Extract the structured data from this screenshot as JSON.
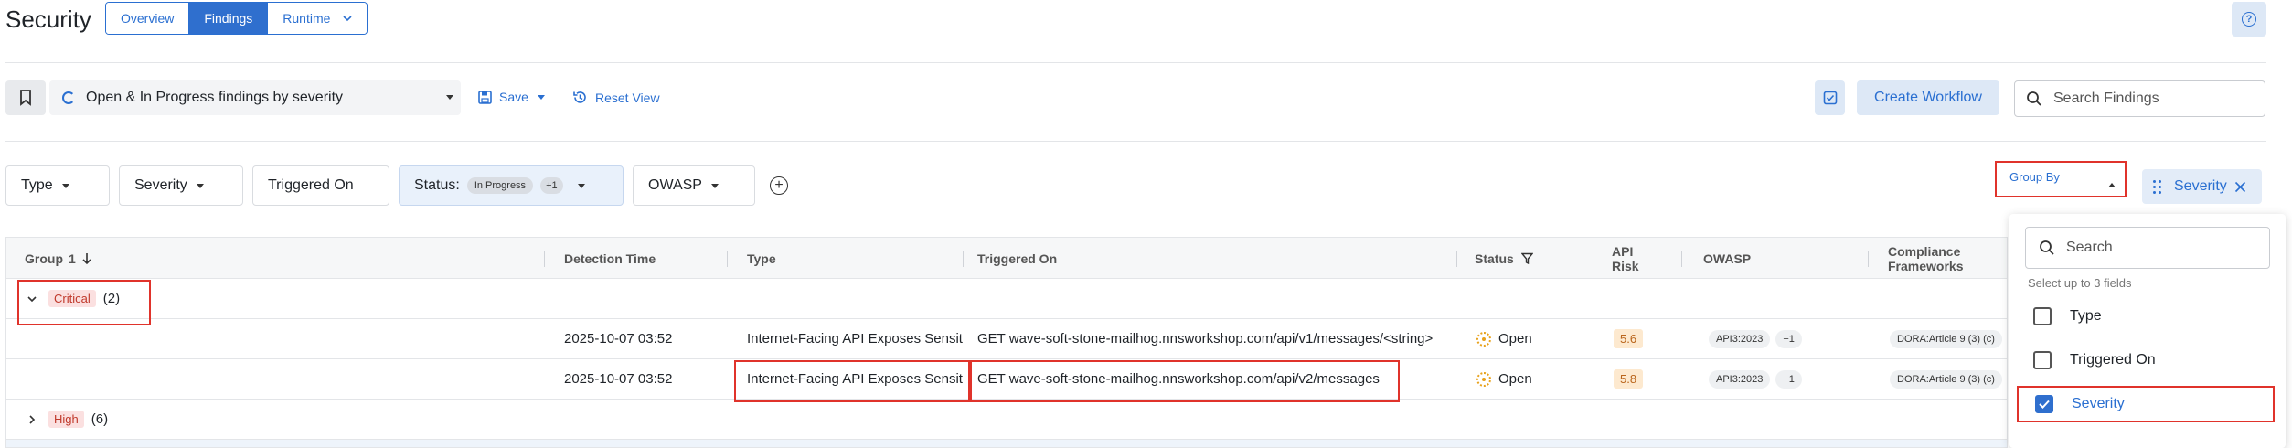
{
  "header": {
    "title": "Security",
    "tabs": [
      {
        "label": "Overview",
        "active": false
      },
      {
        "label": "Findings",
        "active": true
      },
      {
        "label": "Runtime",
        "active": false
      }
    ],
    "help_icon": "question-circle-icon"
  },
  "toolbar": {
    "saved_view": "Open & In Progress findings by severity",
    "save_label": "Save",
    "reset_label": "Reset View",
    "create_workflow_label": "Create Workflow",
    "search_placeholder": "Search Findings"
  },
  "filters": {
    "type": "Type",
    "severity": "Severity",
    "triggered_on": "Triggered On",
    "status_label": "Status:",
    "status_value": "In Progress",
    "status_extra": "+1",
    "owasp": "OWASP",
    "group_by_label": "Group By",
    "group_chip": "Severity"
  },
  "table": {
    "columns": {
      "group": "Group",
      "group_num": "1",
      "detection_time": "Detection Time",
      "type": "Type",
      "triggered_on": "Triggered On",
      "status": "Status",
      "api_risk_1": "API",
      "api_risk_2": "Risk",
      "owasp": "OWASP",
      "compliance_1": "Compliance",
      "compliance_2": "Frameworks"
    },
    "groups": [
      {
        "label": "Critical",
        "count": "(2)"
      },
      {
        "label": "High",
        "count": "(6)"
      }
    ],
    "rows": [
      {
        "detection_time": "2025-10-07 03:52",
        "type": "Internet-Facing API Exposes Sensit",
        "triggered_on": "GET wave-soft-stone-mailhog.nnsworkshop.com/api/v1/messages/<string>",
        "status": "Open",
        "api_risk": "5.6",
        "owasp": "API3:2023",
        "owasp_extra": "+1",
        "compliance": "DORA:Article 9 (3) (c)"
      },
      {
        "detection_time": "2025-10-07 03:52",
        "type": "Internet-Facing API Exposes Sensit",
        "triggered_on": "GET wave-soft-stone-mailhog.nnsworkshop.com/api/v2/messages",
        "status": "Open",
        "api_risk": "5.8",
        "owasp": "API3:2023",
        "owasp_extra": "+1",
        "compliance": "DORA:Article 9 (3) (c)"
      }
    ]
  },
  "group_by_dropdown": {
    "search_placeholder": "Search",
    "hint": "Select up to 3 fields",
    "options": [
      {
        "label": "Type",
        "checked": false
      },
      {
        "label": "Triggered On",
        "checked": false
      },
      {
        "label": "Severity",
        "checked": true
      }
    ]
  },
  "colors": {
    "accent": "#2f6fce",
    "highlight_box": "#e0332b",
    "critical": "#c0392b",
    "risk": "#b9651c"
  }
}
